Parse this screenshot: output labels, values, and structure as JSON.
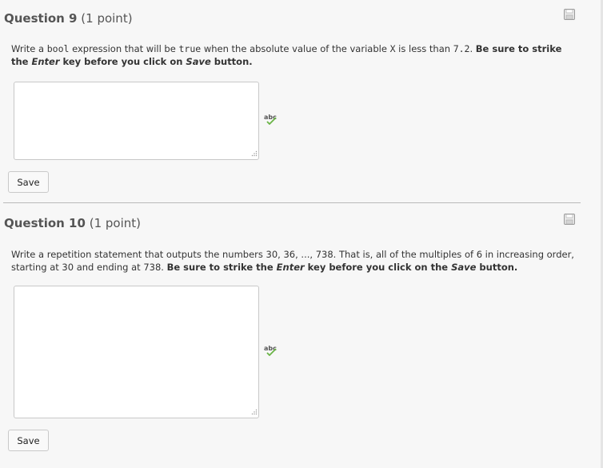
{
  "questions": [
    {
      "number_label": "Question 9",
      "points_label": "(1 point)",
      "prompt": {
        "p1": "Write a ",
        "c1": "bool",
        "p2": " expression that will be ",
        "c2": "true",
        "p3": " when the absolute value of the variable ",
        "c3": "X",
        "p4": " is less than ",
        "c4": "7.2",
        "p5": ". ",
        "b1": "Be sure to strike the ",
        "bi1": "Enter",
        "b2": " key before you click on ",
        "bi2": "Save",
        "b3": " button."
      },
      "answer_value": "",
      "save_label": "Save"
    },
    {
      "number_label": "Question 10",
      "points_label": "(1 point)",
      "prompt": {
        "p1": "Write a repetition statement that outputs the numbers 30, 36, ..., 738. That is, all of the multiples of 6 in increasing order, starting at 30 and ending at 738.   ",
        "b1": "Be sure to strike the ",
        "bi1": "Enter",
        "b2": " key before you click on the ",
        "bi2": "Save",
        "b3": " button."
      },
      "answer_value": "",
      "save_label": "Save"
    }
  ],
  "icons": {
    "save": "floppy-disk-icon",
    "spellcheck": "spellcheck-icon"
  },
  "spellcheck_text": "abc"
}
